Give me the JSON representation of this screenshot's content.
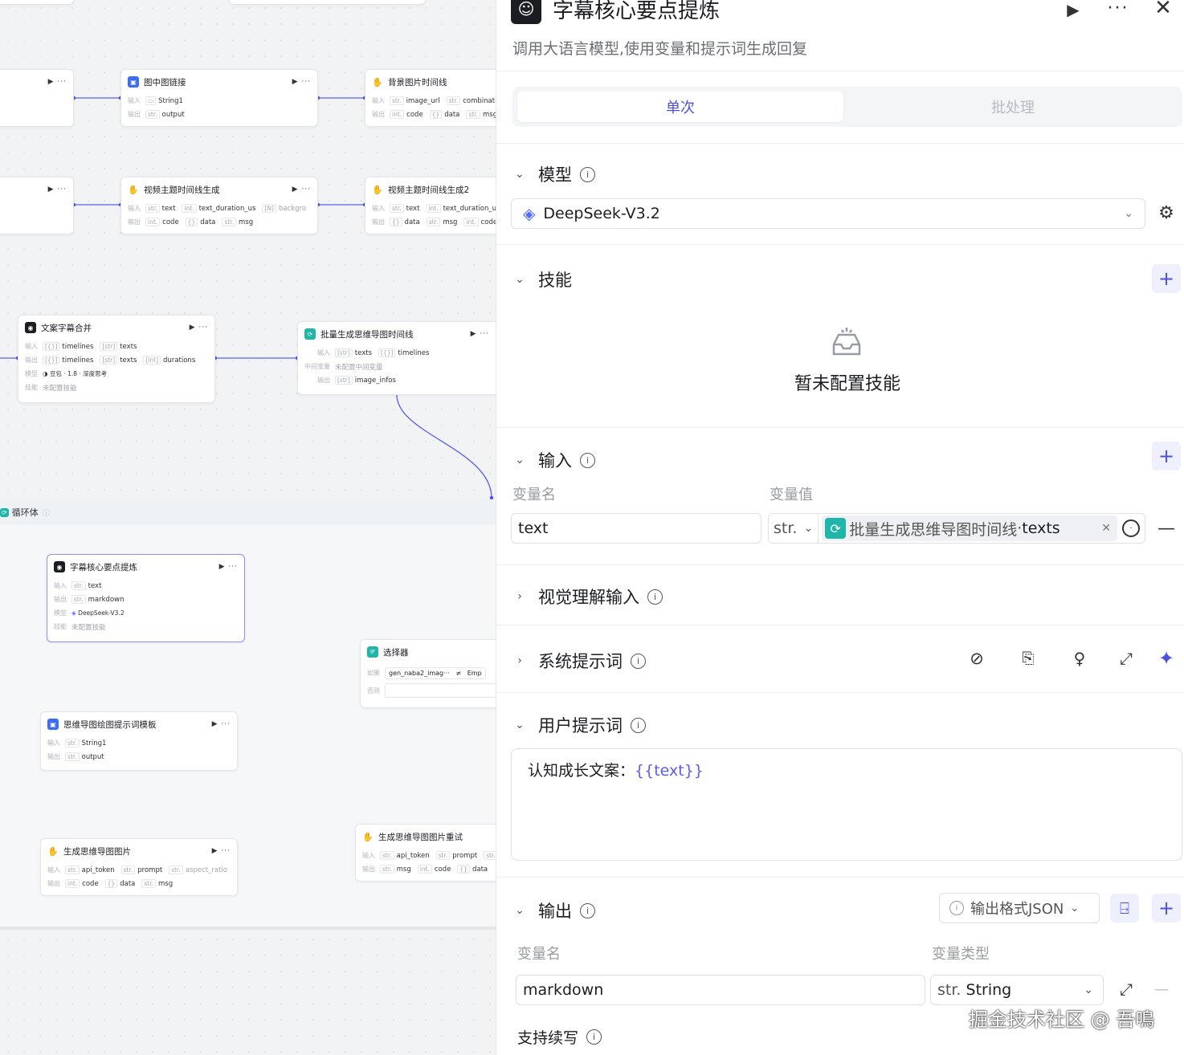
{
  "canvas": {
    "nodes": {
      "n_img_link": {
        "title": "图中图链接",
        "in_label": "输入",
        "out_label": "输出",
        "in": [
          {
            "type": "▭",
            "name": "String1"
          }
        ],
        "out": [
          {
            "type": "str.",
            "name": "output"
          }
        ]
      },
      "n_bg_timeline": {
        "title": "背景图片时间线",
        "in_label": "输入",
        "out_label": "输出",
        "in": [
          {
            "type": "str.",
            "name": "image_url"
          },
          {
            "type": "str.",
            "name": "combination_"
          }
        ],
        "out": [
          {
            "type": "int.",
            "name": "code"
          },
          {
            "type": "{}",
            "name": "data"
          },
          {
            "type": "str.",
            "name": "msg"
          }
        ]
      },
      "n_video_tl": {
        "title": "视频主题时间线生成",
        "in_label": "输入",
        "out_label": "输出",
        "in": [
          {
            "type": "str.",
            "name": "text"
          },
          {
            "type": "int.",
            "name": "text_duration_us"
          },
          {
            "type": "[N]",
            "name": "backgro"
          }
        ],
        "out": [
          {
            "type": "int.",
            "name": "code"
          },
          {
            "type": "{}",
            "name": "data"
          },
          {
            "type": "str.",
            "name": "msg"
          }
        ]
      },
      "n_video_tl2": {
        "title": "视频主题时间线生成2",
        "in_label": "输入",
        "out_label": "输出",
        "in": [
          {
            "type": "str.",
            "name": "text"
          },
          {
            "type": "int.",
            "name": "text_duration_us"
          }
        ],
        "out": [
          {
            "type": "{}",
            "name": "data"
          },
          {
            "type": "str.",
            "name": "msg"
          },
          {
            "type": "int.",
            "name": "code"
          }
        ]
      },
      "n_merge": {
        "title": "文案字幕合并",
        "in_label": "输入",
        "out_label": "输出",
        "model_label": "模型",
        "skill_label": "技能",
        "in": [
          {
            "type": "[{}]",
            "name": "timelines"
          },
          {
            "type": "[str]",
            "name": "texts"
          }
        ],
        "out": [
          {
            "type": "[{}]",
            "name": "timelines"
          },
          {
            "type": "[str]",
            "name": "texts"
          },
          {
            "type": "[int]",
            "name": "durations"
          }
        ],
        "model": "豆包 · 1.8 · 深度思考",
        "skill": "未配置技能"
      },
      "n_batch": {
        "title": "批量生成思维导图时间线",
        "in_label": "输入",
        "mid_label": "中间变量",
        "out_label": "输出",
        "in": [
          {
            "type": "[str]",
            "name": "texts"
          },
          {
            "type": "[{}]",
            "name": "timelines"
          }
        ],
        "mid": "未配置中间变量",
        "out": [
          {
            "type": "[str]",
            "name": "image_infos"
          }
        ]
      },
      "n_core": {
        "title": "字幕核心要点提炼",
        "in_label": "输入",
        "out_label": "输出",
        "model_label": "模型",
        "skill_label": "技能",
        "in": [
          {
            "type": "str.",
            "name": "text"
          }
        ],
        "out": [
          {
            "type": "str.",
            "name": "markdown"
          }
        ],
        "model": "DeepSeek-V3.2",
        "skill": "未配置技能"
      },
      "n_selector": {
        "title": "选择器",
        "if_label": "如果",
        "else_label": "否则",
        "cond_var": "gen_naba2_imag···",
        "cond_op": "≠",
        "cond_val": "Emp"
      },
      "n_mindmap_tpl": {
        "title": "思维导图绘图提示词模板",
        "in_label": "输入",
        "out_label": "输出",
        "in": [
          {
            "type": "str.",
            "name": "String1"
          }
        ],
        "out": [
          {
            "type": "str.",
            "name": "output"
          }
        ]
      },
      "n_gen_img": {
        "title": "生成思维导图图片",
        "in_label": "输入",
        "out_label": "输出",
        "in": [
          {
            "type": "str.",
            "name": "api_token"
          },
          {
            "type": "str.",
            "name": "prompt"
          },
          {
            "type": "str.",
            "name": "aspect_ratio"
          }
        ],
        "out": [
          {
            "type": "int.",
            "name": "code"
          },
          {
            "type": "{}",
            "name": "data"
          },
          {
            "type": "str.",
            "name": "msg"
          }
        ]
      },
      "n_gen_retry": {
        "title": "生成思维导图图片重试",
        "in_label": "输入",
        "out_label": "输出",
        "in": [
          {
            "type": "str.",
            "name": "api_token"
          },
          {
            "type": "str.",
            "name": "prompt"
          },
          {
            "type": "str.",
            "name": "aspec"
          }
        ],
        "out": [
          {
            "type": "str.",
            "name": "msg"
          },
          {
            "type": "int.",
            "name": "code"
          },
          {
            "type": "{}",
            "name": "data"
          }
        ]
      }
    },
    "loop_label": "循环体"
  },
  "panel": {
    "title": "字幕核心要点提炼",
    "subtitle": "调用大语言模型,使用变量和提示词生成回复",
    "tabs": {
      "single": "单次",
      "batch": "批处理"
    },
    "model": {
      "label": "模型",
      "value": "DeepSeek-V3.2"
    },
    "skills": {
      "label": "技能",
      "empty": "暂未配置技能"
    },
    "input": {
      "label": "输入",
      "col_name": "变量名",
      "col_value": "变量值",
      "var_name": "text",
      "var_type": "str.",
      "ref_node": "批量生成思维导图时间线",
      "ref_sep": " · ",
      "ref_var": "texts"
    },
    "vision": {
      "label": "视觉理解输入"
    },
    "system_prompt": {
      "label": "系统提示词"
    },
    "user_prompt": {
      "label": "用户提示词",
      "text": "认知成长文案：",
      "var": "{{text}}"
    },
    "output": {
      "label": "输出",
      "format": "输出格式JSON",
      "col_name": "变量名",
      "col_type": "变量类型",
      "var_name": "markdown",
      "var_type_prefix": "str.",
      "var_type": "String",
      "continue": "支持续写"
    },
    "watermark": "掘金技术社区 @ 吾鳴"
  },
  "colors": {
    "accent": "#4c50e0",
    "tab_active": "#4c50e0",
    "icon_blue": "#3b6cf5",
    "icon_teal": "#1fb5a8"
  }
}
